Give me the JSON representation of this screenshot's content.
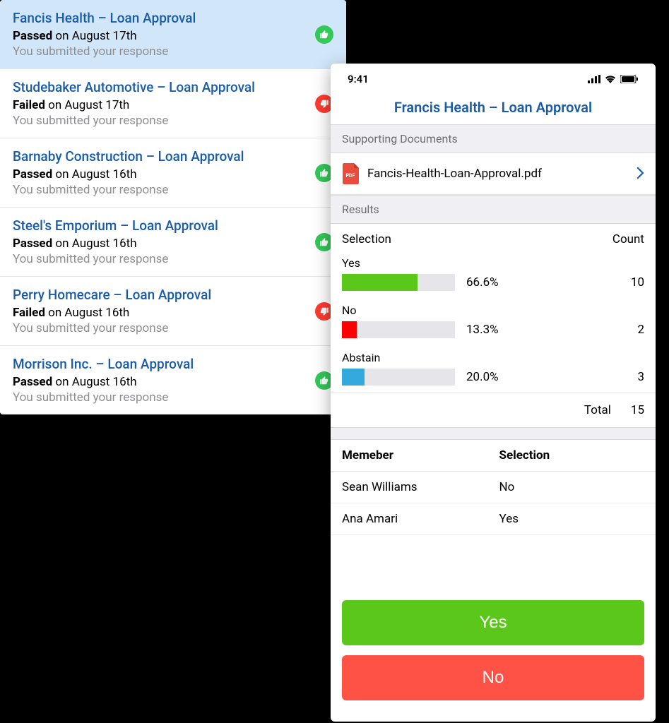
{
  "list": {
    "items": [
      {
        "title": "Fancis Health – Loan Approval",
        "status": "Passed",
        "date": "on August 17th",
        "subtext": "You submitted your response",
        "result": "passed",
        "selected": true
      },
      {
        "title": "Studebaker Automotive – Loan Approval",
        "status": "Failed",
        "date": "on August 17th",
        "subtext": "You submitted your response",
        "result": "failed",
        "selected": false
      },
      {
        "title": "Barnaby Construction – Loan Approval",
        "status": "Passed",
        "date": "on August 16th",
        "subtext": "You submitted your response",
        "result": "passed",
        "selected": false
      },
      {
        "title": "Steel's Emporium  – Loan Approval",
        "status": "Passed",
        "date": "on August 16th",
        "subtext": "You submitted your response",
        "result": "passed",
        "selected": false
      },
      {
        "title": "Perry Homecare – Loan Approval",
        "status": "Failed",
        "date": "on August 16th",
        "subtext": "You submitted your response",
        "result": "failed",
        "selected": false
      },
      {
        "title": "Morrison Inc. – Loan Approval",
        "status": "Passed",
        "date": "on August 16th",
        "subtext": "You submitted your response",
        "result": "passed",
        "selected": false
      }
    ]
  },
  "phone": {
    "time": "9:41",
    "title": "Francis Health – Loan Approval",
    "supporting_header": "Supporting Documents",
    "document": {
      "name": "Fancis-Health-Loan-Approval.pdf",
      "type": "PDF"
    },
    "results_header": "Results",
    "selection_label": "Selection",
    "count_label": "Count",
    "results": [
      {
        "label": "Yes",
        "pct": "66.6%",
        "pct_num": 66.6,
        "count": "10",
        "cls": "yes"
      },
      {
        "label": "No",
        "pct": "13.3%",
        "pct_num": 13.3,
        "count": "2",
        "cls": "no"
      },
      {
        "label": "Abstain",
        "pct": "20.0%",
        "pct_num": 20.0,
        "count": "3",
        "cls": "abstain"
      }
    ],
    "total_label": "Total",
    "total_count": "15",
    "member_header": {
      "col1": "Memeber",
      "col2": "Selection"
    },
    "members": [
      {
        "name": "Sean Williams",
        "selection": "No"
      },
      {
        "name": "Ana Amari",
        "selection": "Yes"
      }
    ],
    "yes_btn": "Yes",
    "no_btn": "No"
  },
  "chart_data": {
    "type": "bar",
    "title": "Results",
    "categories": [
      "Yes",
      "No",
      "Abstain"
    ],
    "series": [
      {
        "name": "Percent",
        "values": [
          66.6,
          13.3,
          20.0
        ]
      },
      {
        "name": "Count",
        "values": [
          10,
          2,
          3
        ]
      }
    ],
    "total": 15
  }
}
